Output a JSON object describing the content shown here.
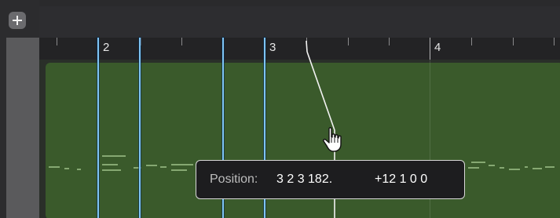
{
  "toolbar": {
    "add_icon": "plus-icon"
  },
  "ruler": {
    "bars": [
      {
        "label": "2"
      },
      {
        "label": "3"
      },
      {
        "label": "4"
      }
    ]
  },
  "tooltip": {
    "label": "Position:",
    "position_value": "3 2 3 182.",
    "length_value": "+12 1 0 0"
  },
  "colors": {
    "region_fill": "#3a5a2b",
    "marker_line": "#7ec4f4",
    "note_color": "#8fb07a",
    "tooltip_bg": "#1d1d1f"
  },
  "cursor": {
    "icon": "pointing-hand-cursor-icon"
  }
}
